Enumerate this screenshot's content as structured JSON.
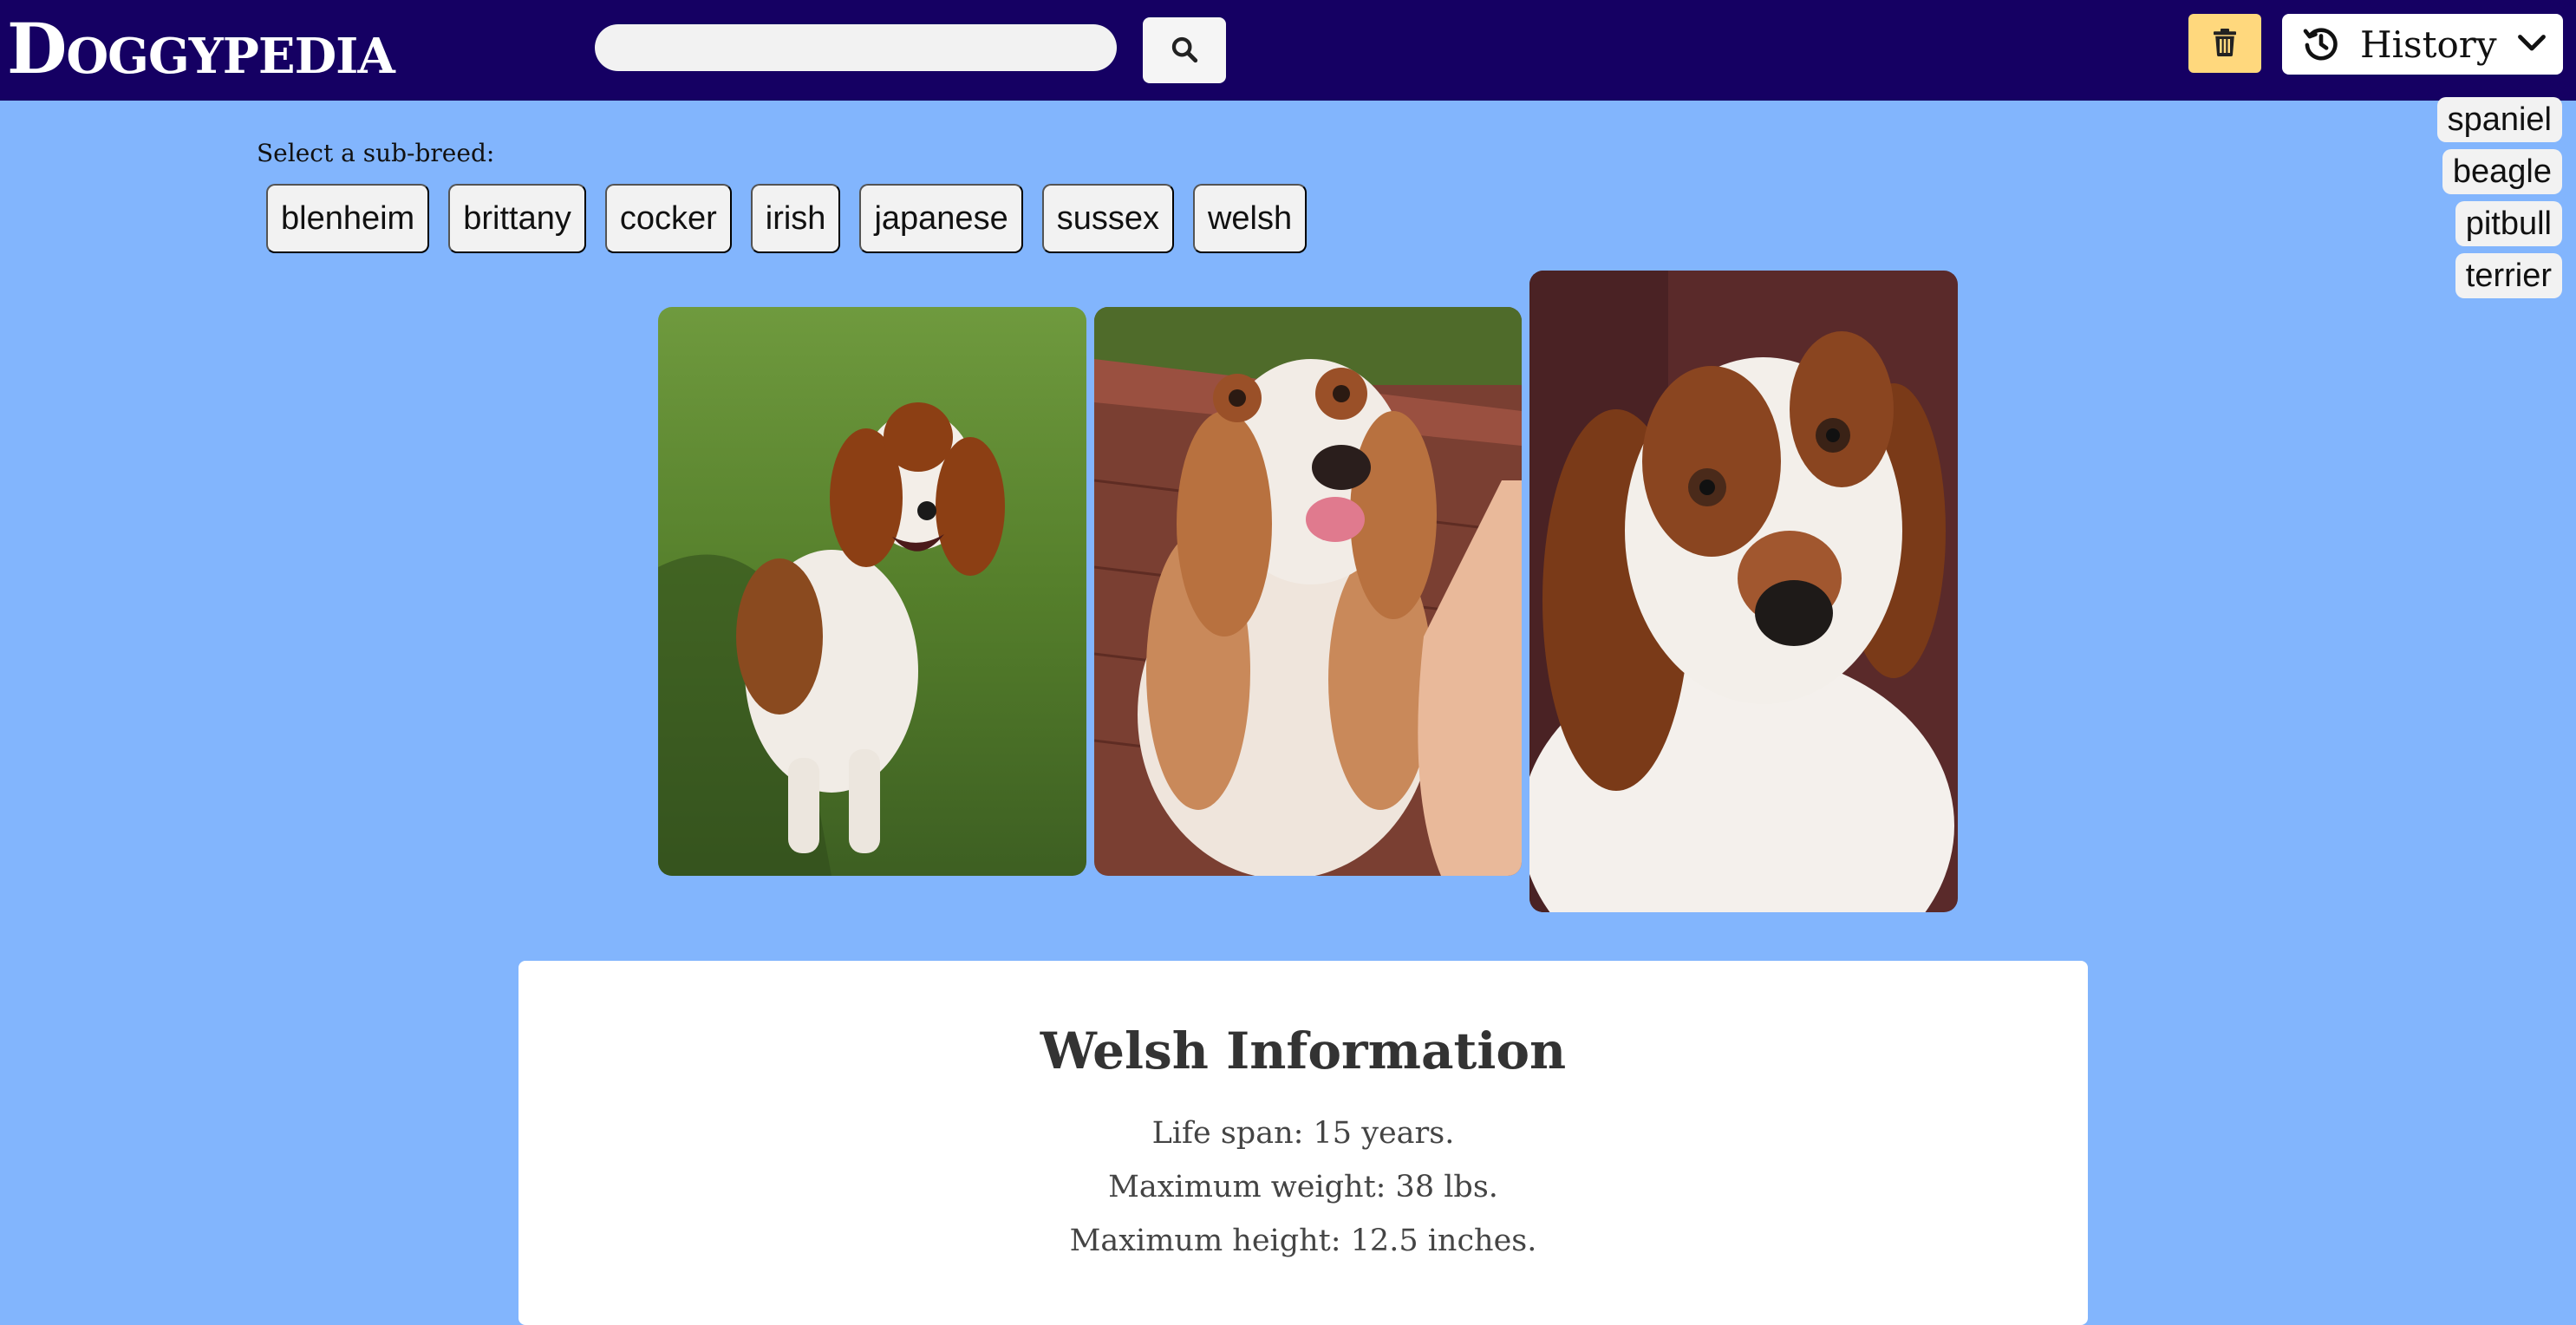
{
  "header": {
    "logo": "Doggypedia",
    "search_value": "",
    "search_icon": "search-icon",
    "trash_icon": "trash-icon",
    "history_label": "History",
    "history_icon": "history-icon",
    "dropdown_icon": "chevron-down-icon",
    "background_color": "#150063",
    "trash_color": "#ffd87d"
  },
  "history": {
    "items": [
      "spaniel",
      "beagle",
      "pitbull",
      "terrier"
    ]
  },
  "subbreeds": {
    "label": "Select a sub-breed:",
    "items": [
      "blenheim",
      "brittany",
      "cocker",
      "irish",
      "japanese",
      "sussex",
      "welsh"
    ]
  },
  "photos": [
    {
      "name": "dog-photo-1",
      "scene": "grass"
    },
    {
      "name": "dog-photo-2",
      "scene": "brick"
    },
    {
      "name": "dog-photo-3",
      "scene": "dark"
    }
  ],
  "info": {
    "title": "Welsh Information",
    "lines": [
      "Life span: 15 years.",
      "Maximum weight: 38 lbs.",
      "Maximum height: 12.5 inches."
    ]
  },
  "page": {
    "background_color": "#82b5fd"
  }
}
